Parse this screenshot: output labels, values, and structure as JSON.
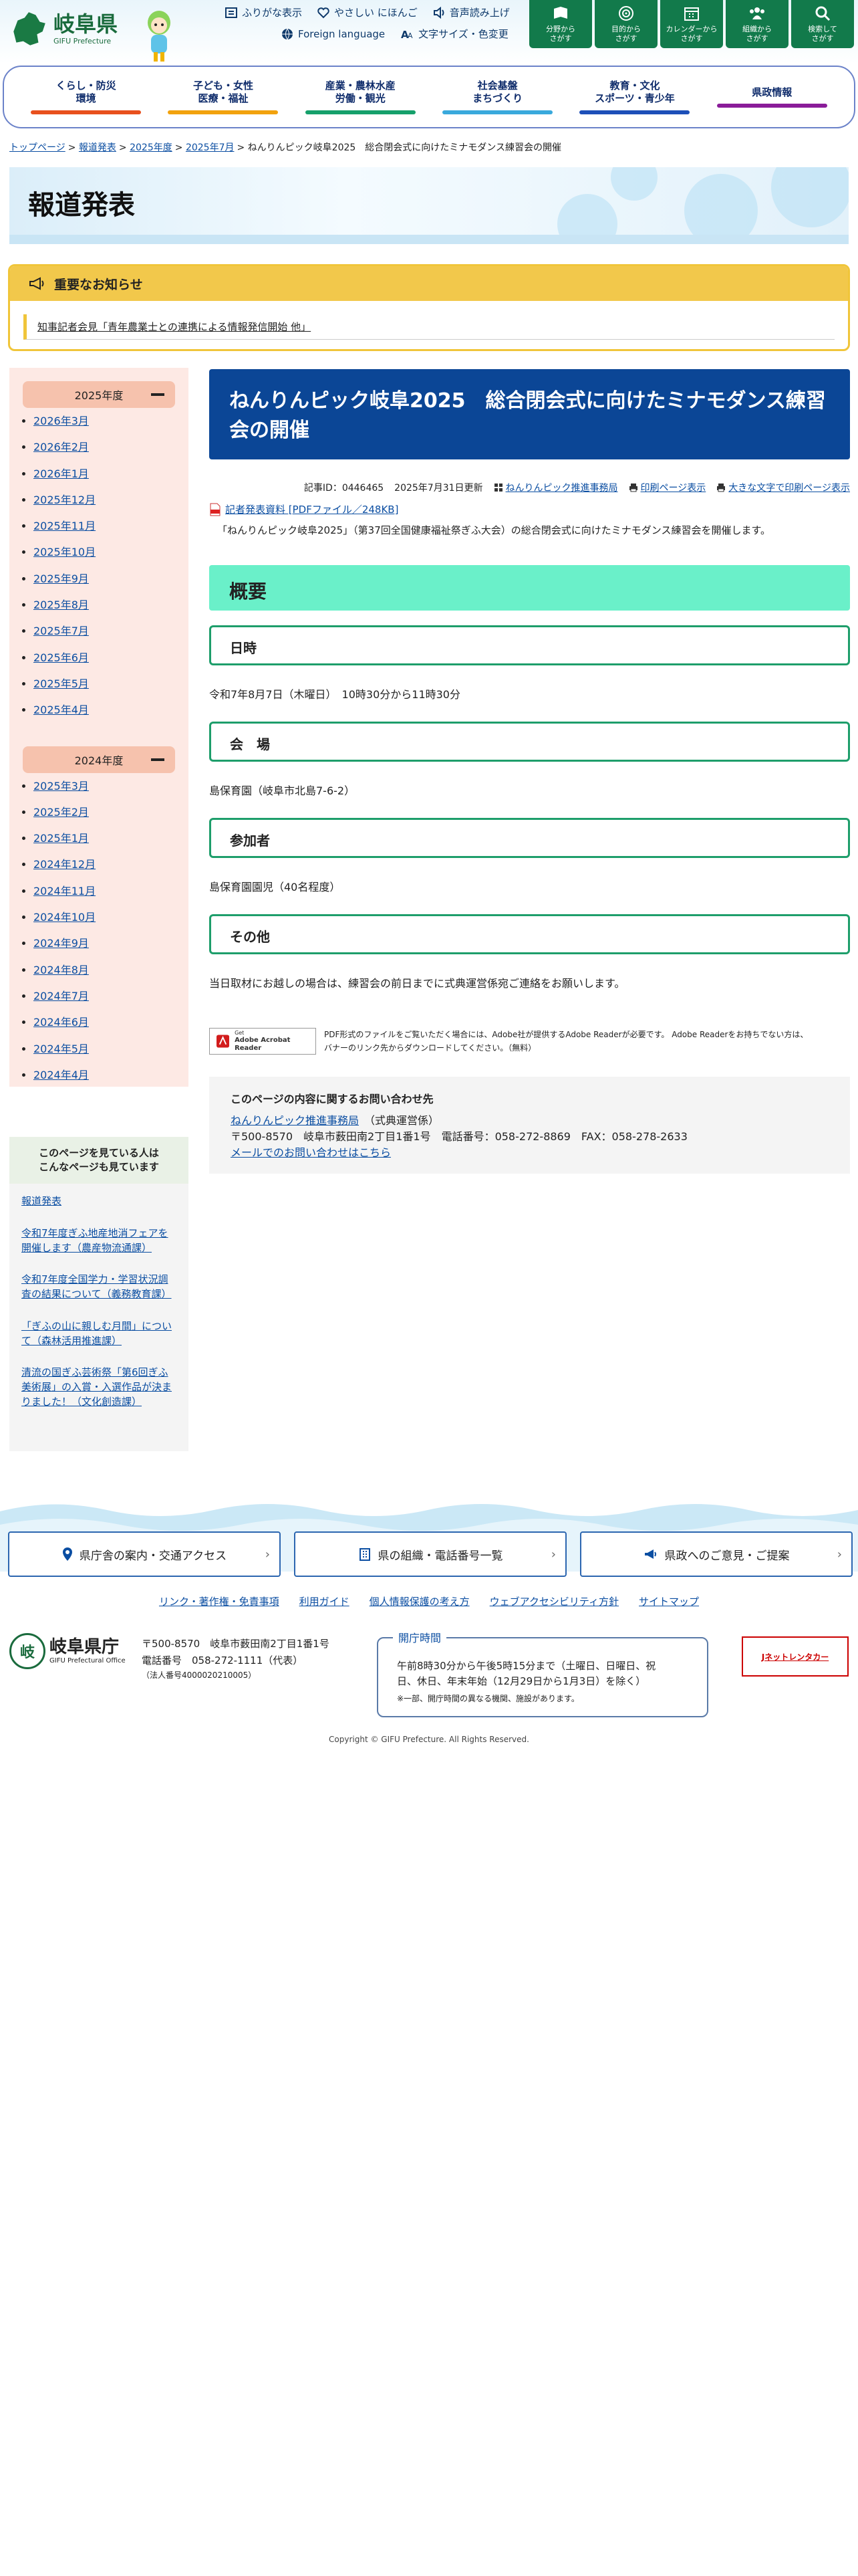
{
  "header": {
    "logo_jp": "岐阜県",
    "logo_en": "GIFU Prefecture",
    "util_row1": [
      {
        "icon": "furigana-icon",
        "label": "ふりがな表示"
      },
      {
        "icon": "heart-icon",
        "label": "やさしい にほんご"
      },
      {
        "icon": "speaker-icon",
        "label": "音声読み上げ"
      }
    ],
    "util_row2": [
      {
        "icon": "globe-icon",
        "label": "Foreign language"
      },
      {
        "icon": "text-size-icon",
        "label": "文字サイズ・色変更"
      }
    ],
    "quick_nav": [
      {
        "icon": "book-icon",
        "l1": "分野から",
        "l2": "さがす"
      },
      {
        "icon": "target-icon",
        "l1": "目的から",
        "l2": "さがす"
      },
      {
        "icon": "calendar-icon",
        "l1": "カレンダーから",
        "l2": "さがす"
      },
      {
        "icon": "people-icon",
        "l1": "組織から",
        "l2": "さがす"
      },
      {
        "icon": "search-icon",
        "l1": "検索して",
        "l2": "さがす"
      }
    ],
    "global_nav": [
      {
        "l1": "くらし・防災",
        "l2": "環境",
        "color": "#e8501e"
      },
      {
        "l1": "子ども・女性",
        "l2": "医療・福祉",
        "color": "#f2a20d"
      },
      {
        "l1": "産業・農林水産",
        "l2": "労働・観光",
        "color": "#16a06b"
      },
      {
        "l1": "社会基盤",
        "l2": "まちづくり",
        "color": "#39a9dc"
      },
      {
        "l1": "教育・文化",
        "l2": "スポーツ・青少年",
        "color": "#1d4fb8"
      },
      {
        "l1": "県政情報",
        "l2": "",
        "color": "#8a1c99"
      }
    ]
  },
  "breadcrumb": {
    "links": [
      "トップページ",
      "報道発表",
      "2025年度",
      "2025年7月"
    ],
    "sep": ">",
    "current": "ねんりんピック岐阜2025　総合閉会式に向けたミナモダンス練習会の開催"
  },
  "banner_title": "報道発表",
  "notice": {
    "title": "重要なお知らせ",
    "item": "知事記者会見「青年農業士との連携による情報発信開始 他」"
  },
  "sidebar": {
    "years": [
      {
        "label": "2025年度",
        "months": [
          "2026年3月",
          "2026年2月",
          "2026年1月",
          "2025年12月",
          "2025年11月",
          "2025年10月",
          "2025年9月",
          "2025年8月",
          "2025年7月",
          "2025年6月",
          "2025年5月",
          "2025年4月"
        ]
      },
      {
        "label": "2024年度",
        "months": [
          "2025年3月",
          "2025年2月",
          "2025年1月",
          "2024年12月",
          "2024年11月",
          "2024年10月",
          "2024年9月",
          "2024年8月",
          "2024年7月",
          "2024年6月",
          "2024年5月",
          "2024年4月"
        ]
      }
    ]
  },
  "related": {
    "title_l1": "このページを見ている人は",
    "title_l2": "こんなページも見ています",
    "items": [
      "報道発表",
      "令和7年度ぎふ地産地消フェアを開催します（農産物流通課）",
      "令和7年度全国学力・学習状況調査の結果について（義務教育課）",
      "「ぎふの山に親しむ月間」について（森林活用推進課）",
      "清流の国ぎふ芸術祭「第6回ぎふ美術展」の入賞・入選作品が決まりました！（文化創造課）"
    ]
  },
  "article": {
    "title": "ねんりんピック岐阜2025　総合閉会式に向けたミナモダンス練習会の開催",
    "id_label": "記事ID：0446465",
    "updated": "2025年7月31日更新",
    "dept_link": "ねんりんピック推進事務局",
    "print": "印刷ページ表示",
    "print_large": "大きな文字で印刷ページ表示",
    "pdf_link": "記者発表資料 [PDFファイル／248KB]",
    "lead": "「ねんりんピック岐阜2025」（第37回全国健康福祉祭ぎふ大会）の総合閉会式に向けたミナモダンス練習会を開催します。",
    "h2": "概要",
    "sections": [
      {
        "h": "日時",
        "p": "令和7年8月7日（木曜日）　10時30分から11時30分"
      },
      {
        "h": "会　場",
        "p": "島保育園（岐阜市北島7-6-2）"
      },
      {
        "h": "参加者",
        "p": "島保育園園児（40名程度）"
      },
      {
        "h": "その他",
        "p": "当日取材にお越しの場合は、練習会の前日までに式典運営係宛ご連絡をお願いします。"
      }
    ],
    "acrobat_get": "Get",
    "acrobat_name": "Adobe Acrobat Reader",
    "acrobat_l1": "PDF形式のファイルをご覧いただく場合には、Adobe社が提供するAdobe Readerが必要です。 Adobe Readerをお持ちでない方は、",
    "acrobat_l2": "バナーのリンク先からダウンロードしてください。（無料）",
    "contact": {
      "title": "このページの内容に関するお問い合わせ先",
      "dept": "ねんりんピック推進事務局",
      "section": "（式典運営係）",
      "address": "〒500-8570　岐阜市薮田南2丁目1番1号　電話番号：058-272-8869　FAX：058-278-2633",
      "mail": "メールでのお問い合わせはこちら"
    }
  },
  "footer": {
    "buttons": [
      {
        "icon": "pin-icon",
        "label": "県庁舎の案内・交通アクセス"
      },
      {
        "icon": "building-icon",
        "label": "県の組織・電話番号一覧"
      },
      {
        "icon": "megaphone-icon",
        "label": "県政へのご意見・ご提案"
      }
    ],
    "links": [
      "リンク・著作権・免責事項",
      "利用ガイド",
      "個人情報保護の考え方",
      "ウェブアクセシビリティ方針",
      "サイトマップ"
    ],
    "office_jp": "岐阜県庁",
    "office_en": "GIFU Prefectural Office",
    "addr1": "〒500-8570　岐阜市薮田南2丁目1番1号",
    "addr2": "電話番号　058-272-1111（代表）",
    "addr3": "（法人番号4000020210005）",
    "hours_title": "開庁時間",
    "hours_l1": "午前8時30分から午後5時15分まで（土曜日、日曜日、祝",
    "hours_l2": "日、休日、年末年始（12月29日から1月3日）を除く）",
    "hours_note": "※一部、開庁時間の異なる機関、施設があります。",
    "jnet": "Jネットレンタカー",
    "copyright": "Copyright © GIFU Prefecture. All Rights Reserved."
  }
}
